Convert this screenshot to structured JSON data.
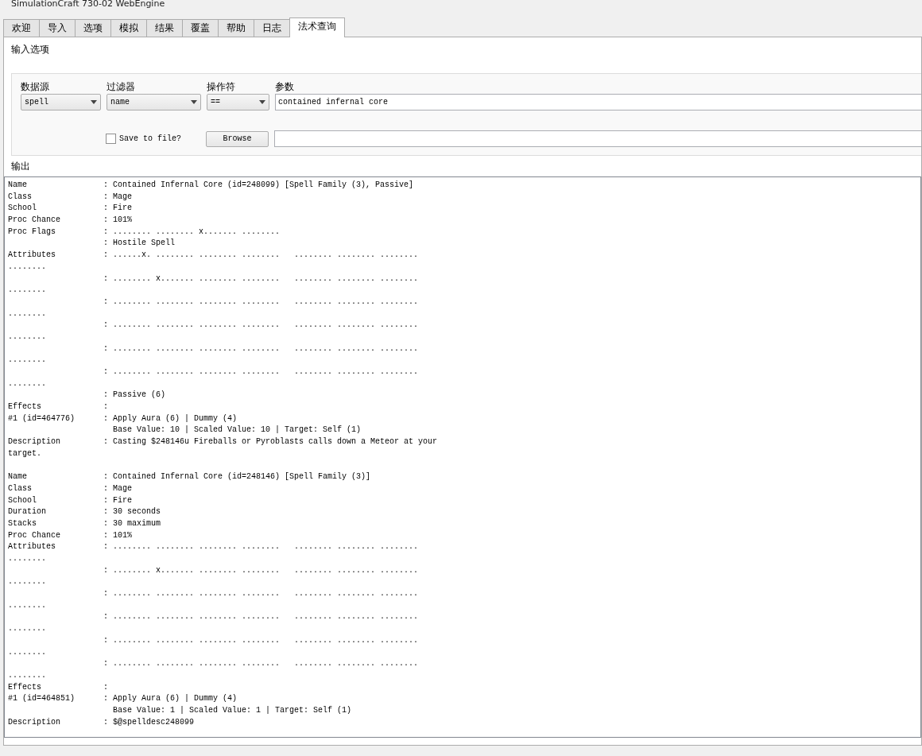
{
  "window": {
    "title": "SimulationCraft 730-02 WebEngine"
  },
  "tabs": [
    {
      "label": "欢迎",
      "selected": false
    },
    {
      "label": "导入",
      "selected": false
    },
    {
      "label": "选项",
      "selected": false
    },
    {
      "label": "模拟",
      "selected": false
    },
    {
      "label": "结果",
      "selected": false
    },
    {
      "label": "覆盖",
      "selected": false
    },
    {
      "label": "帮助",
      "selected": false
    },
    {
      "label": "日志",
      "selected": false
    },
    {
      "label": "法术查询",
      "selected": true
    }
  ],
  "input_options": {
    "title": "输入选项",
    "fields": [
      {
        "label": "数据源",
        "kind": "combo",
        "value": "spell"
      },
      {
        "label": "过滤器",
        "kind": "combo",
        "value": "name"
      },
      {
        "label": "操作符",
        "kind": "combo",
        "value": "=="
      },
      {
        "label": "参数",
        "kind": "text",
        "value": "contained infernal core"
      }
    ],
    "save_to_file": {
      "label": "Save to file?",
      "checked": false
    },
    "browse_button": "Browse"
  },
  "output": {
    "title": "输出",
    "records": [
      {
        "lines": [
          "Name                : Contained Infernal Core (id=248099) [Spell Family (3), Passive]",
          "Class               : Mage",
          "School              : Fire",
          "Proc Chance         : 101%",
          "Proc Flags          : ........ ........ x....... ........",
          "                    : Hostile Spell",
          "Attributes          : ......x. ........ ........ ........   ........ ........ ........",
          "........",
          "                    : ........ x....... ........ ........   ........ ........ ........",
          "........",
          "                    : ........ ........ ........ ........   ........ ........ ........",
          "........",
          "                    : ........ ........ ........ ........   ........ ........ ........",
          "........",
          "                    : ........ ........ ........ ........   ........ ........ ........",
          "........",
          "                    : ........ ........ ........ ........   ........ ........ ........",
          "........",
          "                    : Passive (6)",
          "Effects             :",
          "#1 (id=464776)      : Apply Aura (6) | Dummy (4)",
          "                      Base Value: 10 | Scaled Value: 10 | Target: Self (1)",
          "Description         : Casting $248146u Fireballs or Pyroblasts calls down a Meteor at your",
          "target."
        ]
      },
      {
        "lines": [
          "Name                : Contained Infernal Core (id=248146) [Spell Family (3)]",
          "Class               : Mage",
          "School              : Fire",
          "Duration            : 30 seconds",
          "Stacks              : 30 maximum",
          "Proc Chance         : 101%",
          "Attributes          : ........ ........ ........ ........   ........ ........ ........",
          "........",
          "                    : ........ x....... ........ ........   ........ ........ ........",
          "........",
          "                    : ........ ........ ........ ........   ........ ........ ........",
          "........",
          "                    : ........ ........ ........ ........   ........ ........ ........",
          "........",
          "                    : ........ ........ ........ ........   ........ ........ ........",
          "........",
          "                    : ........ ........ ........ ........   ........ ........ ........",
          "........",
          "Effects             :",
          "#1 (id=464851)      : Apply Aura (6) | Dummy (4)",
          "                      Base Value: 1 | Scaled Value: 1 | Target: Self (1)",
          "Description         : $@spelldesc248099"
        ]
      }
    ]
  }
}
